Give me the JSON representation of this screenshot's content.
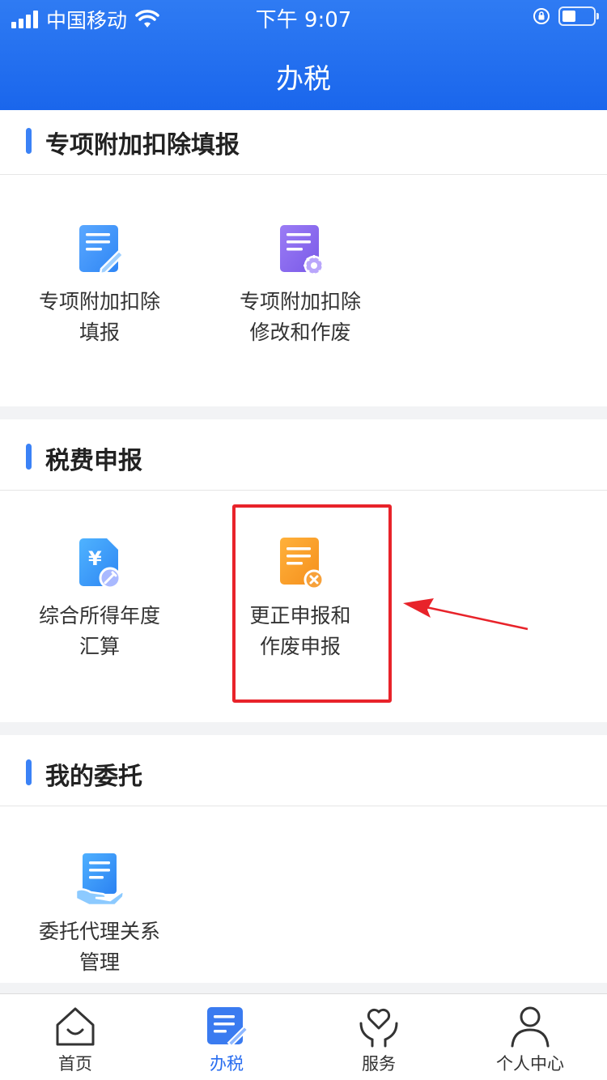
{
  "status_bar": {
    "carrier": "中国移动",
    "time": "下午 9:07"
  },
  "header": {
    "title": "办税"
  },
  "sections": [
    {
      "title": "专项附加扣除填报",
      "items": [
        {
          "label_line1": "专项附加扣除",
          "label_line2": "填报",
          "icon": "document-edit-icon"
        },
        {
          "label_line1": "专项附加扣除",
          "label_line2": "修改和作废",
          "icon": "document-settings-icon"
        }
      ]
    },
    {
      "title": "税费申报",
      "items": [
        {
          "label_line1": "综合所得年度",
          "label_line2": "汇算",
          "icon": "yuan-document-icon"
        },
        {
          "label_line1": "更正申报和",
          "label_line2": "作废申报",
          "icon": "document-cancel-icon"
        }
      ]
    },
    {
      "title": "我的委托",
      "items": [
        {
          "label_line1": "委托代理关系",
          "label_line2": "管理",
          "icon": "document-hand-icon"
        }
      ]
    }
  ],
  "tabbar": {
    "items": [
      {
        "label": "首页",
        "icon": "home-icon",
        "active": false
      },
      {
        "label": "办税",
        "icon": "tax-document-icon",
        "active": true
      },
      {
        "label": "服务",
        "icon": "heart-hands-icon",
        "active": false
      },
      {
        "label": "个人中心",
        "icon": "person-icon",
        "active": false
      }
    ]
  },
  "colors": {
    "header_blue": "#1a66ec",
    "accent_blue": "#3b82f6",
    "highlight_red": "#e8232a",
    "active_tab": "#2a6ef0"
  }
}
